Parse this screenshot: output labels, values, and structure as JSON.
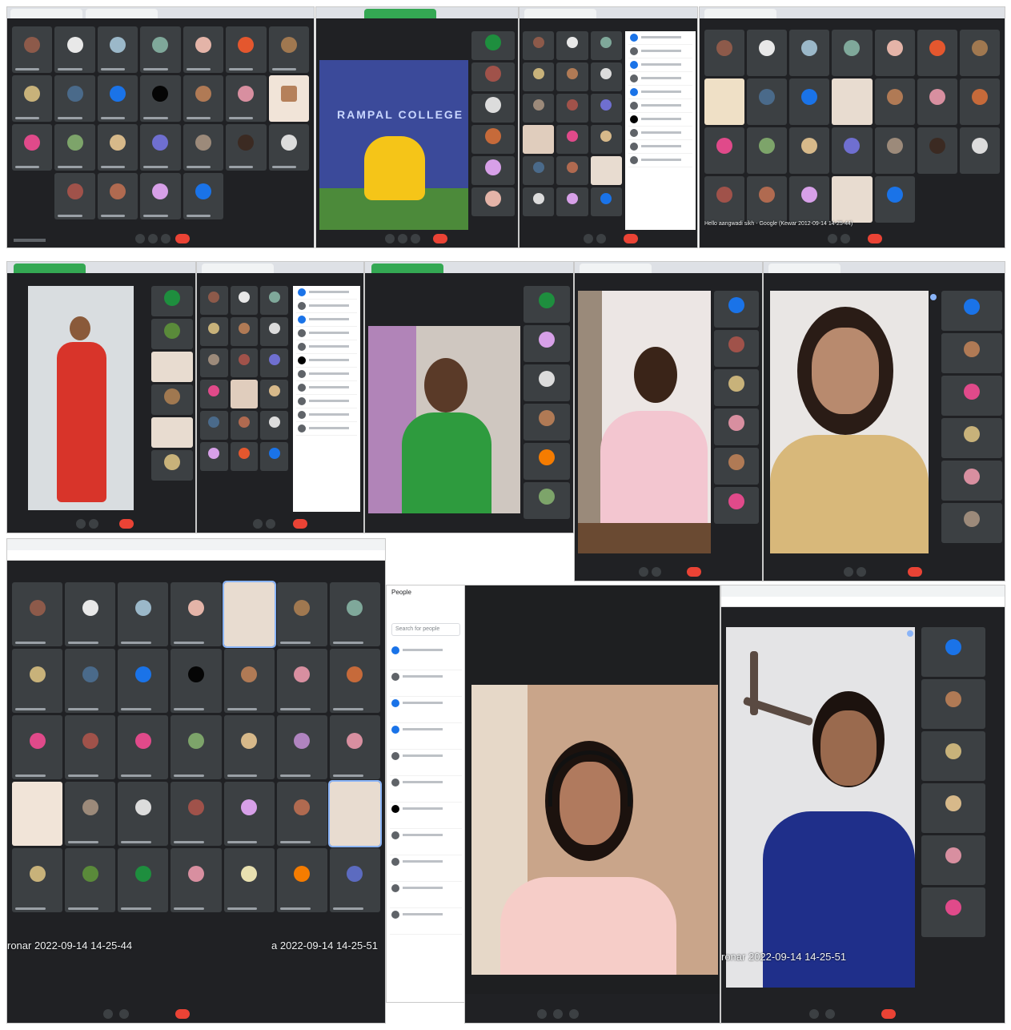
{
  "collage": {
    "label": "Google Meet session screenshots collage"
  },
  "panel1": {
    "stamp": ""
  },
  "panel2": {
    "banner_text": "RAMPAL COLLEGE"
  },
  "panel11": {
    "stamp_left": "ronar 2022-09-14 14-25-44",
    "stamp_right": "a 2022-09-14 14-25-51"
  },
  "panel12": {
    "people_header": "People",
    "search_placeholder": "Search for people"
  },
  "panel13": {
    "stamp": "ronar 2022-09-14 14-25-51"
  },
  "panel4": {
    "caption": "Hello aangwadi sikh - Google (Kewar 2012-09-14 14-25-44)"
  },
  "colors": {
    "meet_bg": "#202124",
    "tile_bg": "#3c4043",
    "end_call": "#ea4335",
    "avatar_blue": "#1a73e8"
  }
}
